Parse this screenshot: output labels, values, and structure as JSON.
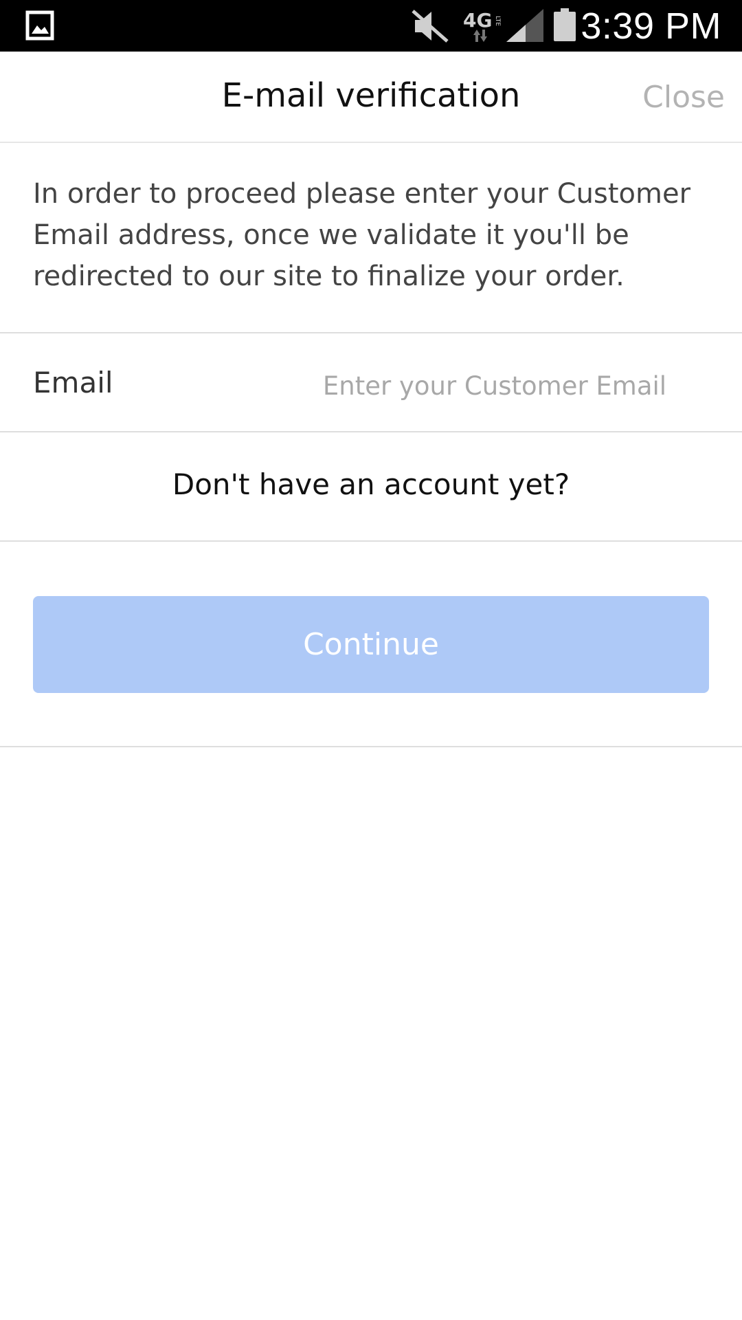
{
  "status_bar": {
    "time": "3:39 PM",
    "network": "4G",
    "network_sub": "LTE",
    "icons": [
      "gallery-icon",
      "mute-icon",
      "network-4g-lte-icon",
      "signal-icon",
      "battery-icon"
    ]
  },
  "header": {
    "title": "E-mail verification",
    "close_label": "Close"
  },
  "description": "In order to proceed please enter your Customer Email address, once we validate it you'll be redirected to our site to finalize your order.",
  "email": {
    "label": "Email",
    "value": "",
    "placeholder": "Enter your Customer Email"
  },
  "account_link": "Don't have an account yet?",
  "continue_button": {
    "label": "Continue",
    "enabled": false
  },
  "colors": {
    "status_bar_bg": "#000000",
    "background": "#ffffff",
    "divider": "#dedede",
    "button_bg": "#aec9f7",
    "button_text": "#ffffff",
    "close_text": "#b3b3b3",
    "placeholder_text": "#a8a8a8"
  }
}
